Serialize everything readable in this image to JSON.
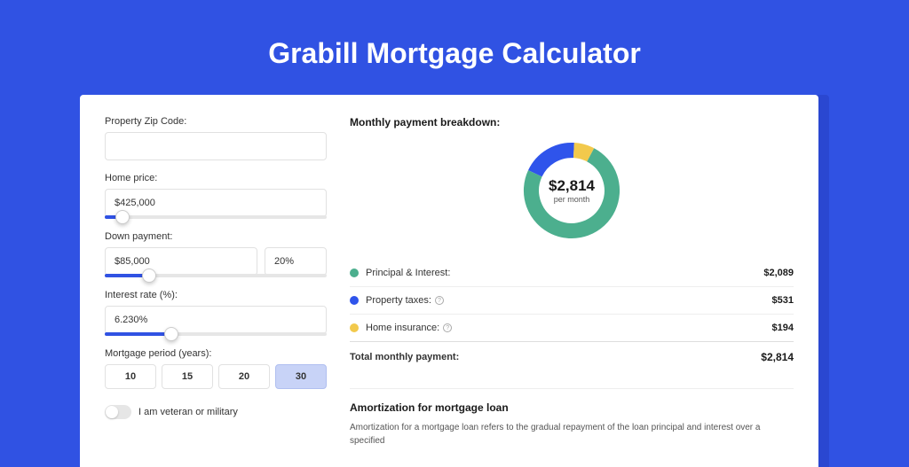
{
  "title": "Grabill Mortgage Calculator",
  "form": {
    "zip": {
      "label": "Property Zip Code:",
      "value": ""
    },
    "home_price": {
      "label": "Home price:",
      "value": "$425,000",
      "slider_pct": 8
    },
    "down_payment": {
      "label": "Down payment:",
      "value": "$85,000",
      "pct": "20%",
      "slider_pct": 20
    },
    "interest": {
      "label": "Interest rate (%):",
      "value": "6.230%",
      "slider_pct": 30
    },
    "period": {
      "label": "Mortgage period (years):",
      "options": [
        "10",
        "15",
        "20",
        "30"
      ],
      "selected": "30"
    },
    "veteran": {
      "label": "I am veteran or military",
      "checked": false
    }
  },
  "breakdown": {
    "title": "Monthly payment breakdown:",
    "center_value": "$2,814",
    "center_sub": "per month",
    "items": [
      {
        "label": "Principal & Interest:",
        "value": "$2,089",
        "color": "#4caf8e",
        "has_info": false
      },
      {
        "label": "Property taxes:",
        "value": "$531",
        "color": "#2f54eb",
        "has_info": true
      },
      {
        "label": "Home insurance:",
        "value": "$194",
        "color": "#f2c94c",
        "has_info": true
      }
    ],
    "total": {
      "label": "Total monthly payment:",
      "value": "$2,814"
    }
  },
  "amortization": {
    "title": "Amortization for mortgage loan",
    "text": "Amortization for a mortgage loan refers to the gradual repayment of the loan principal and interest over a specified"
  },
  "chart_data": {
    "type": "pie",
    "title": "Monthly payment breakdown",
    "series": [
      {
        "name": "Principal & Interest",
        "value": 2089,
        "color": "#4caf8e"
      },
      {
        "name": "Property taxes",
        "value": 531,
        "color": "#2f54eb"
      },
      {
        "name": "Home insurance",
        "value": 194,
        "color": "#f2c94c"
      }
    ],
    "total": 2814,
    "unit": "USD per month"
  }
}
